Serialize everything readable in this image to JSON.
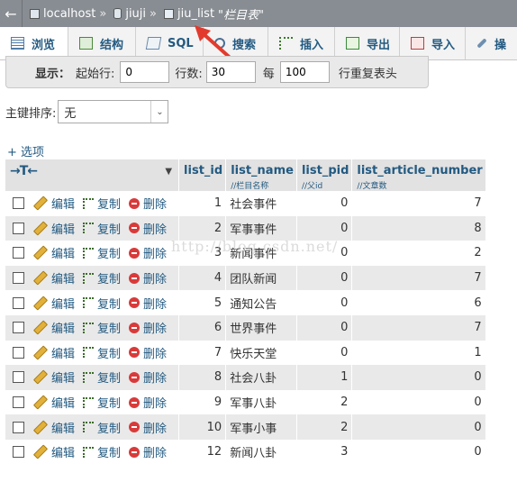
{
  "breadcrumb": {
    "back_glyph": "←",
    "server": "localhost",
    "separator": "»",
    "database": "jiuji",
    "table": "jiu_list",
    "table_comment": "\"栏目表\""
  },
  "tabs": [
    {
      "label": "浏览",
      "icon": "browse-icon",
      "active": true
    },
    {
      "label": "结构",
      "icon": "structure-icon"
    },
    {
      "label": "SQL",
      "icon": "sql-icon"
    },
    {
      "label": "搜索",
      "icon": "search-icon"
    },
    {
      "label": "插入",
      "icon": "insert-icon"
    },
    {
      "label": "导出",
      "icon": "export-icon"
    },
    {
      "label": "导入",
      "icon": "import-icon"
    },
    {
      "label": "操",
      "icon": "operations-icon"
    }
  ],
  "display_options": {
    "show_label": "显示：",
    "start_row_label": "起始行:",
    "start_row_value": "0",
    "row_count_label": "行数:",
    "row_count_value": "30",
    "per_label": "每",
    "repeat_value": "100",
    "repeat_label": "行重复表头"
  },
  "sort": {
    "label": "主键排序:",
    "selected": "无",
    "arrow": "⌄"
  },
  "options_link": "+ 选项",
  "table": {
    "sort_arrows": "→T←",
    "sort_triangle": "▼",
    "columns": [
      {
        "name": "list_id",
        "comment": ""
      },
      {
        "name": "list_name",
        "comment": "//栏目名称"
      },
      {
        "name": "list_pid",
        "comment": "//父id"
      },
      {
        "name": "list_article_number",
        "comment": "//文章数"
      }
    ],
    "actions": {
      "edit": "编辑",
      "copy": "复制",
      "delete": "删除"
    },
    "rows": [
      {
        "id": "1",
        "name": "社会事件",
        "pid": "0",
        "num": "7"
      },
      {
        "id": "2",
        "name": "军事事件",
        "pid": "0",
        "num": "8"
      },
      {
        "id": "3",
        "name": "新闻事件",
        "pid": "0",
        "num": "2"
      },
      {
        "id": "4",
        "name": "团队新闻",
        "pid": "0",
        "num": "7"
      },
      {
        "id": "5",
        "name": "通知公告",
        "pid": "0",
        "num": "6"
      },
      {
        "id": "6",
        "name": "世界事件",
        "pid": "0",
        "num": "7"
      },
      {
        "id": "7",
        "name": "快乐天堂",
        "pid": "0",
        "num": "1"
      },
      {
        "id": "8",
        "name": "社会八卦",
        "pid": "1",
        "num": "0"
      },
      {
        "id": "9",
        "name": "军事八卦",
        "pid": "2",
        "num": "0"
      },
      {
        "id": "10",
        "name": "军事小事",
        "pid": "2",
        "num": "0"
      },
      {
        "id": "12",
        "name": "新闻八卦",
        "pid": "3",
        "num": "0"
      }
    ]
  },
  "watermark": "http://blog.csdn.net/",
  "colors": {
    "accent": "#235a81",
    "header_bar": "#888d93",
    "row_alt": "#e9e9e9",
    "annotation": "#e23b2e"
  }
}
